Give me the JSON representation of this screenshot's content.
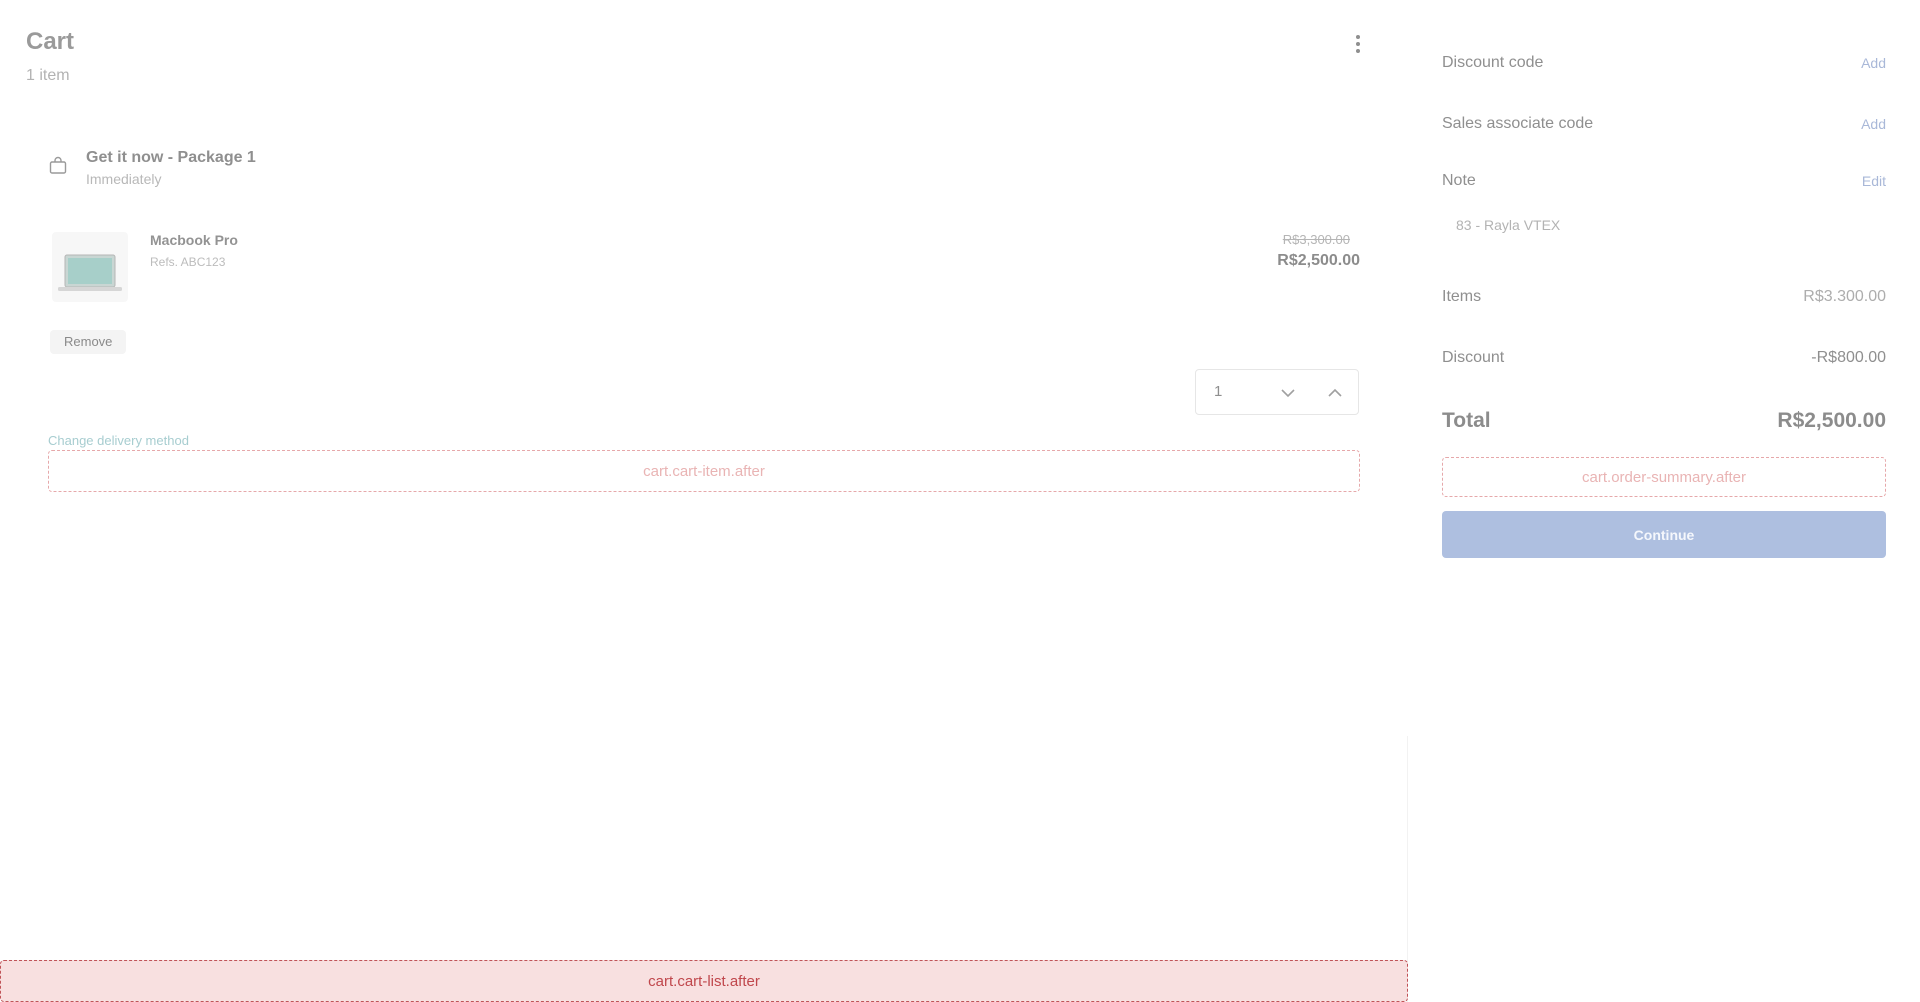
{
  "header": {
    "title": "Cart",
    "item_count": "1 item",
    "menu_icon": "kebab-menu-icon"
  },
  "package": {
    "icon": "bag-icon",
    "title": "Get it now - Package 1",
    "subtitle": "Immediately"
  },
  "product": {
    "image_icon": "laptop-icon",
    "name": "Macbook Pro",
    "ref": "Refs. ABC123",
    "price_original": "R$3,300.00",
    "price_current": "R$2,500.00",
    "remove_label": "Remove",
    "quantity": "1"
  },
  "cart": {
    "change_delivery": "Change delivery method",
    "cart_item_after_slot": "cart.cart-item.after",
    "cart_list_after_slot": "cart.cart-list.after"
  },
  "summary": {
    "discount_code_label": "Discount code",
    "discount_code_action": "Add",
    "sales_associate_label": "Sales associate code",
    "sales_associate_action": "Add",
    "note_label": "Note",
    "note_action": "Edit",
    "note_value": "83 - Rayla VTEX",
    "items_label": "Items",
    "items_value": "R$3.300.00",
    "discount_label": "Discount",
    "discount_value": "-R$800.00",
    "total_label": "Total",
    "total_value": "R$2,500.00",
    "order_summary_after_slot": "cart.order-summary.after",
    "continue_label": "Continue"
  },
  "colors": {
    "accent_link": "#a9b8d8",
    "primary_button": "#aebfe0",
    "slot_border": "#e6a8aa",
    "slot_list_bg": "#f8e0e0",
    "delivery_link": "#a7cdd0"
  }
}
